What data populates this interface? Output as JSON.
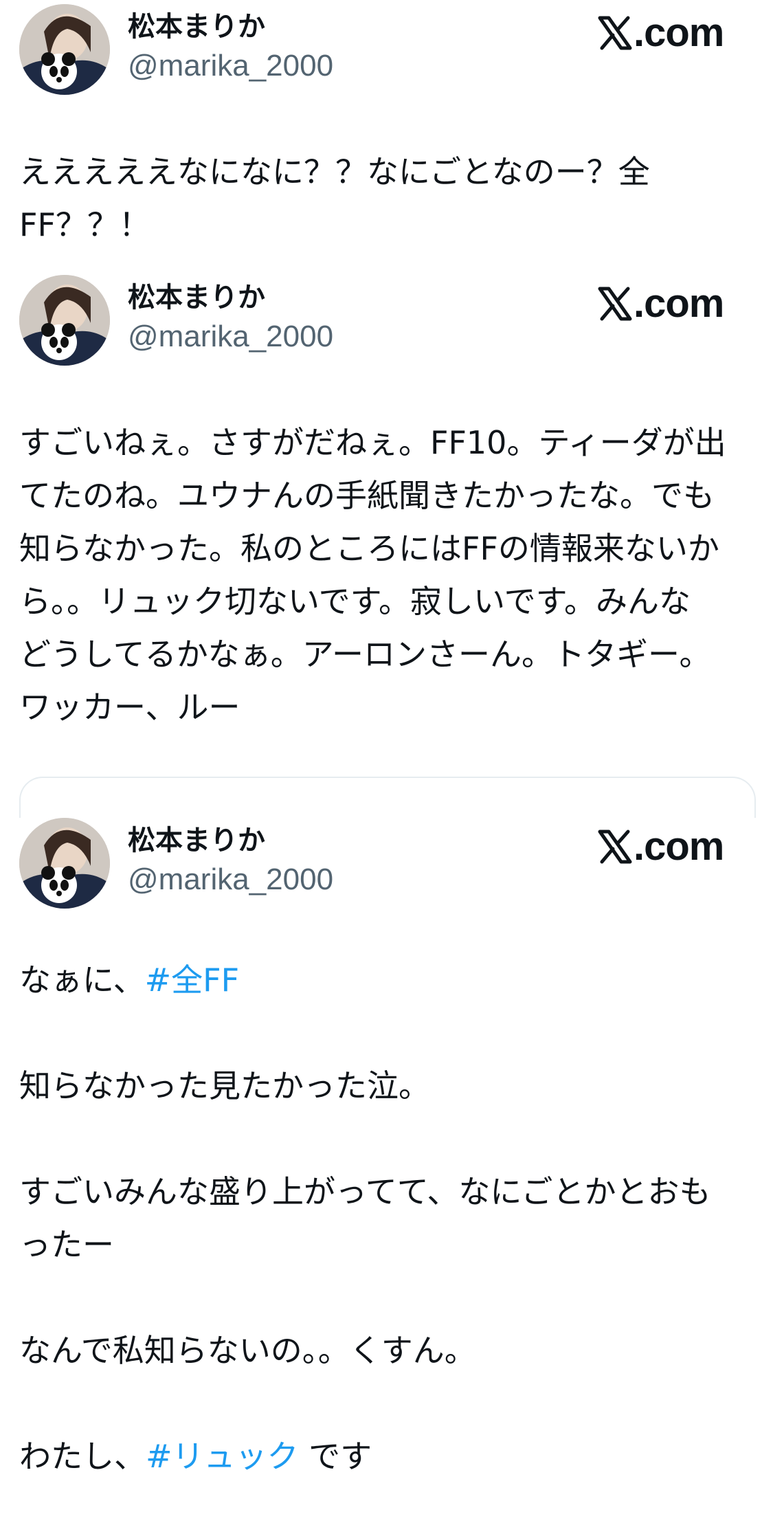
{
  "brand": {
    "x_logo_icon": "x-logo-icon",
    "suffix": ".com"
  },
  "colors": {
    "hashtag": "#1d9bf0",
    "handle": "#536471",
    "text": "#0f1419"
  },
  "tweets": [
    {
      "user": {
        "name": "松本まりか",
        "handle": "@marika_2000",
        "avatar_icon": "user-avatar"
      },
      "lines": [
        "えええええなになに？？なにごとなのー？全",
        "FF？？！"
      ]
    },
    {
      "user": {
        "name": "松本まりか",
        "handle": "@marika_2000",
        "avatar_icon": "user-avatar"
      },
      "lines": [
        "すごいねぇ。さすがだねぇ。FF10。ティーダが出",
        "てたのね。ユウナんの手紙聞きたかったな。でも",
        "知らなかった。私のところにはFFの情報来ないか",
        "ら。。リュック切ないです。寂しいです。みんな",
        "どうしてるかなぁ。アーロンさーん。トタギー。",
        "ワッカー、ルー"
      ]
    },
    {
      "user": {
        "name": "松本まりか",
        "handle": "@marika_2000",
        "avatar_icon": "user-avatar"
      },
      "p1_text": "なぁに、",
      "p1_hashtag": "#全FF",
      "p2": "知らなかった見たかった泣。",
      "p3_line1": "すごいみんな盛り上がってて、なにごとかとおも",
      "p3_line2": "ったー",
      "p4": "なんで私知らないの。。くすん。",
      "p5_text": "わたし、",
      "p5_hashtag": "#リュック",
      "p5_after": " です"
    }
  ]
}
